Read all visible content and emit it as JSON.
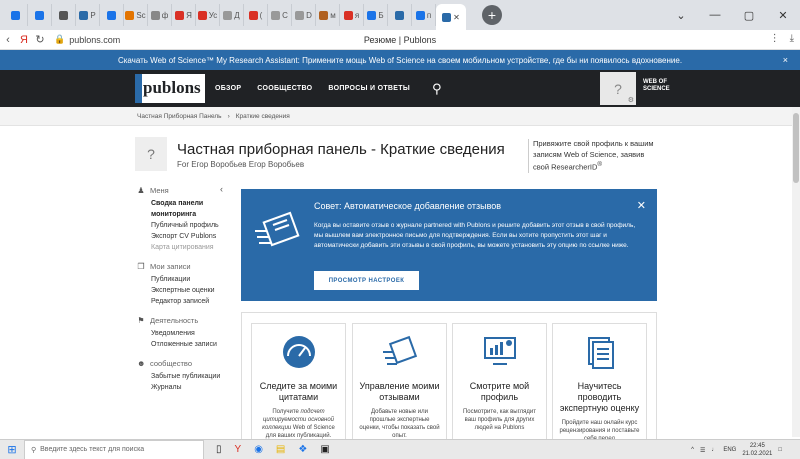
{
  "browser": {
    "tabs": [
      {
        "label": "",
        "color": "#1a73e8"
      },
      {
        "label": "",
        "color": "#1a73e8"
      },
      {
        "label": "",
        "color": "#555555"
      },
      {
        "label": "P",
        "color": "#2a6aa8"
      },
      {
        "label": "",
        "color": "#1a73e8"
      },
      {
        "label": "Sc",
        "color": "#e37400"
      },
      {
        "label": "ф",
        "color": "#888888"
      },
      {
        "label": "Я",
        "color": "#d93025"
      },
      {
        "label": "Ус",
        "color": "#d93025"
      },
      {
        "label": "Д",
        "color": "#999999"
      },
      {
        "label": "(",
        "color": "#d93025"
      },
      {
        "label": "С",
        "color": "#999999"
      },
      {
        "label": "D",
        "color": "#999999"
      },
      {
        "label": "м",
        "color": "#b06020"
      },
      {
        "label": "я",
        "color": "#d93025"
      },
      {
        "label": "Б",
        "color": "#1a73e8"
      },
      {
        "label": "",
        "color": "#2a6aa8"
      },
      {
        "label": "п",
        "color": "#1a73e8"
      }
    ],
    "active_tab": {
      "label": "P",
      "close": "✕"
    },
    "new_tab": "+",
    "window_controls": [
      "⌄",
      "—",
      "▢",
      "✕"
    ],
    "url": "publons.com",
    "page_title": "Резюме | Publons"
  },
  "banner": {
    "text": "Скачать Web of Science™ My Research Assistant: Примените мощь Web of Science на своем мобильном устройстве, где бы ни появилось вдохновение.",
    "close": "×"
  },
  "header": {
    "logo": "publons",
    "nav": [
      "ОБЗОР",
      "СООБЩЕСТВО",
      "ВОПРОСЫ И ОТВЕТЫ"
    ],
    "avatar_placeholder": "?",
    "wos_line1": "WEB OF",
    "wos_line2": "SCIENCE"
  },
  "breadcrumb": {
    "items": [
      "Частная Приборная Панель",
      "Краткие сведения"
    ]
  },
  "profile": {
    "avatar_placeholder": "?",
    "title": "Частная приборная панель - Краткие сведения",
    "subtitle": "For Егор Воробьев Егор Воробьев",
    "claim_text": "Привяжите свой профиль к вашим записям Web of Science, заявив свой ResearcherID"
  },
  "sidebar": {
    "collapse": "‹",
    "groups": [
      {
        "title": "Меня",
        "items": [
          {
            "label": "Сводка панели мониторинга",
            "state": "active"
          },
          {
            "label": "Публичный профиль",
            "state": "normal"
          },
          {
            "label": "Экспорт CV Publons",
            "state": "normal"
          },
          {
            "label": "Карта цитирования",
            "state": "muted"
          }
        ]
      },
      {
        "title": "Мои записи",
        "items": [
          {
            "label": "Публикации",
            "state": "normal"
          },
          {
            "label": "Экспертные оценки",
            "state": "normal"
          },
          {
            "label": "Редактор записей",
            "state": "normal"
          }
        ]
      },
      {
        "title": "Деятельность",
        "items": [
          {
            "label": "Уведомления",
            "state": "normal"
          },
          {
            "label": "Отложенные записи",
            "state": "normal"
          }
        ]
      },
      {
        "title": "сообщество",
        "items": [
          {
            "label": "Забытые публикации",
            "state": "normal"
          },
          {
            "label": "Журналы",
            "state": "normal"
          }
        ]
      }
    ]
  },
  "tip": {
    "title": "Совет: Автоматическое добавление отзывов",
    "body": "Когда вы оставите отзыв о журнале partnered with Publons и решите добавить этот отзыв в свой профиль, мы вышлем вам электронное письмо для подтверждения. Если вы хотите пропустить этот шаг и автоматически добавить эти отзывы в свой профиль, вы можете установить эту опцию по ссылке ниже.",
    "button": "ПРОСМОТР НАСТРОЕК",
    "close": "✕"
  },
  "cards": [
    {
      "title": "Следите за моими цитатами",
      "desc_plain": "Получите ",
      "desc_italic": "подсчет цитируемости основной коллекции",
      "desc_tail": " Web of Science для ваших публикаций."
    },
    {
      "title": "Управление моими отзывами",
      "desc_plain": "Добавьте новые или прошлые экспертные оценки, чтобы показать свой опыт.",
      "desc_italic": "",
      "desc_tail": ""
    },
    {
      "title": "Смотрите мой профиль",
      "desc_plain": "Посмотрите, как выглядит ваш профиль для других людей на Publons",
      "desc_italic": "",
      "desc_tail": ""
    },
    {
      "title": "Научитесь проводить экспертную оценку",
      "desc_plain": "Пройдите наш онлайн курс рецензирования и поставьте себя перед",
      "desc_italic": "",
      "desc_tail": ""
    }
  ],
  "taskbar": {
    "search_placeholder": "Введите здесь текст для поиска",
    "lang": "ENG",
    "time": "22:45",
    "date": "21.02.2021"
  },
  "colors": {
    "accent": "#2a6aa8",
    "header_bg": "#202225"
  }
}
